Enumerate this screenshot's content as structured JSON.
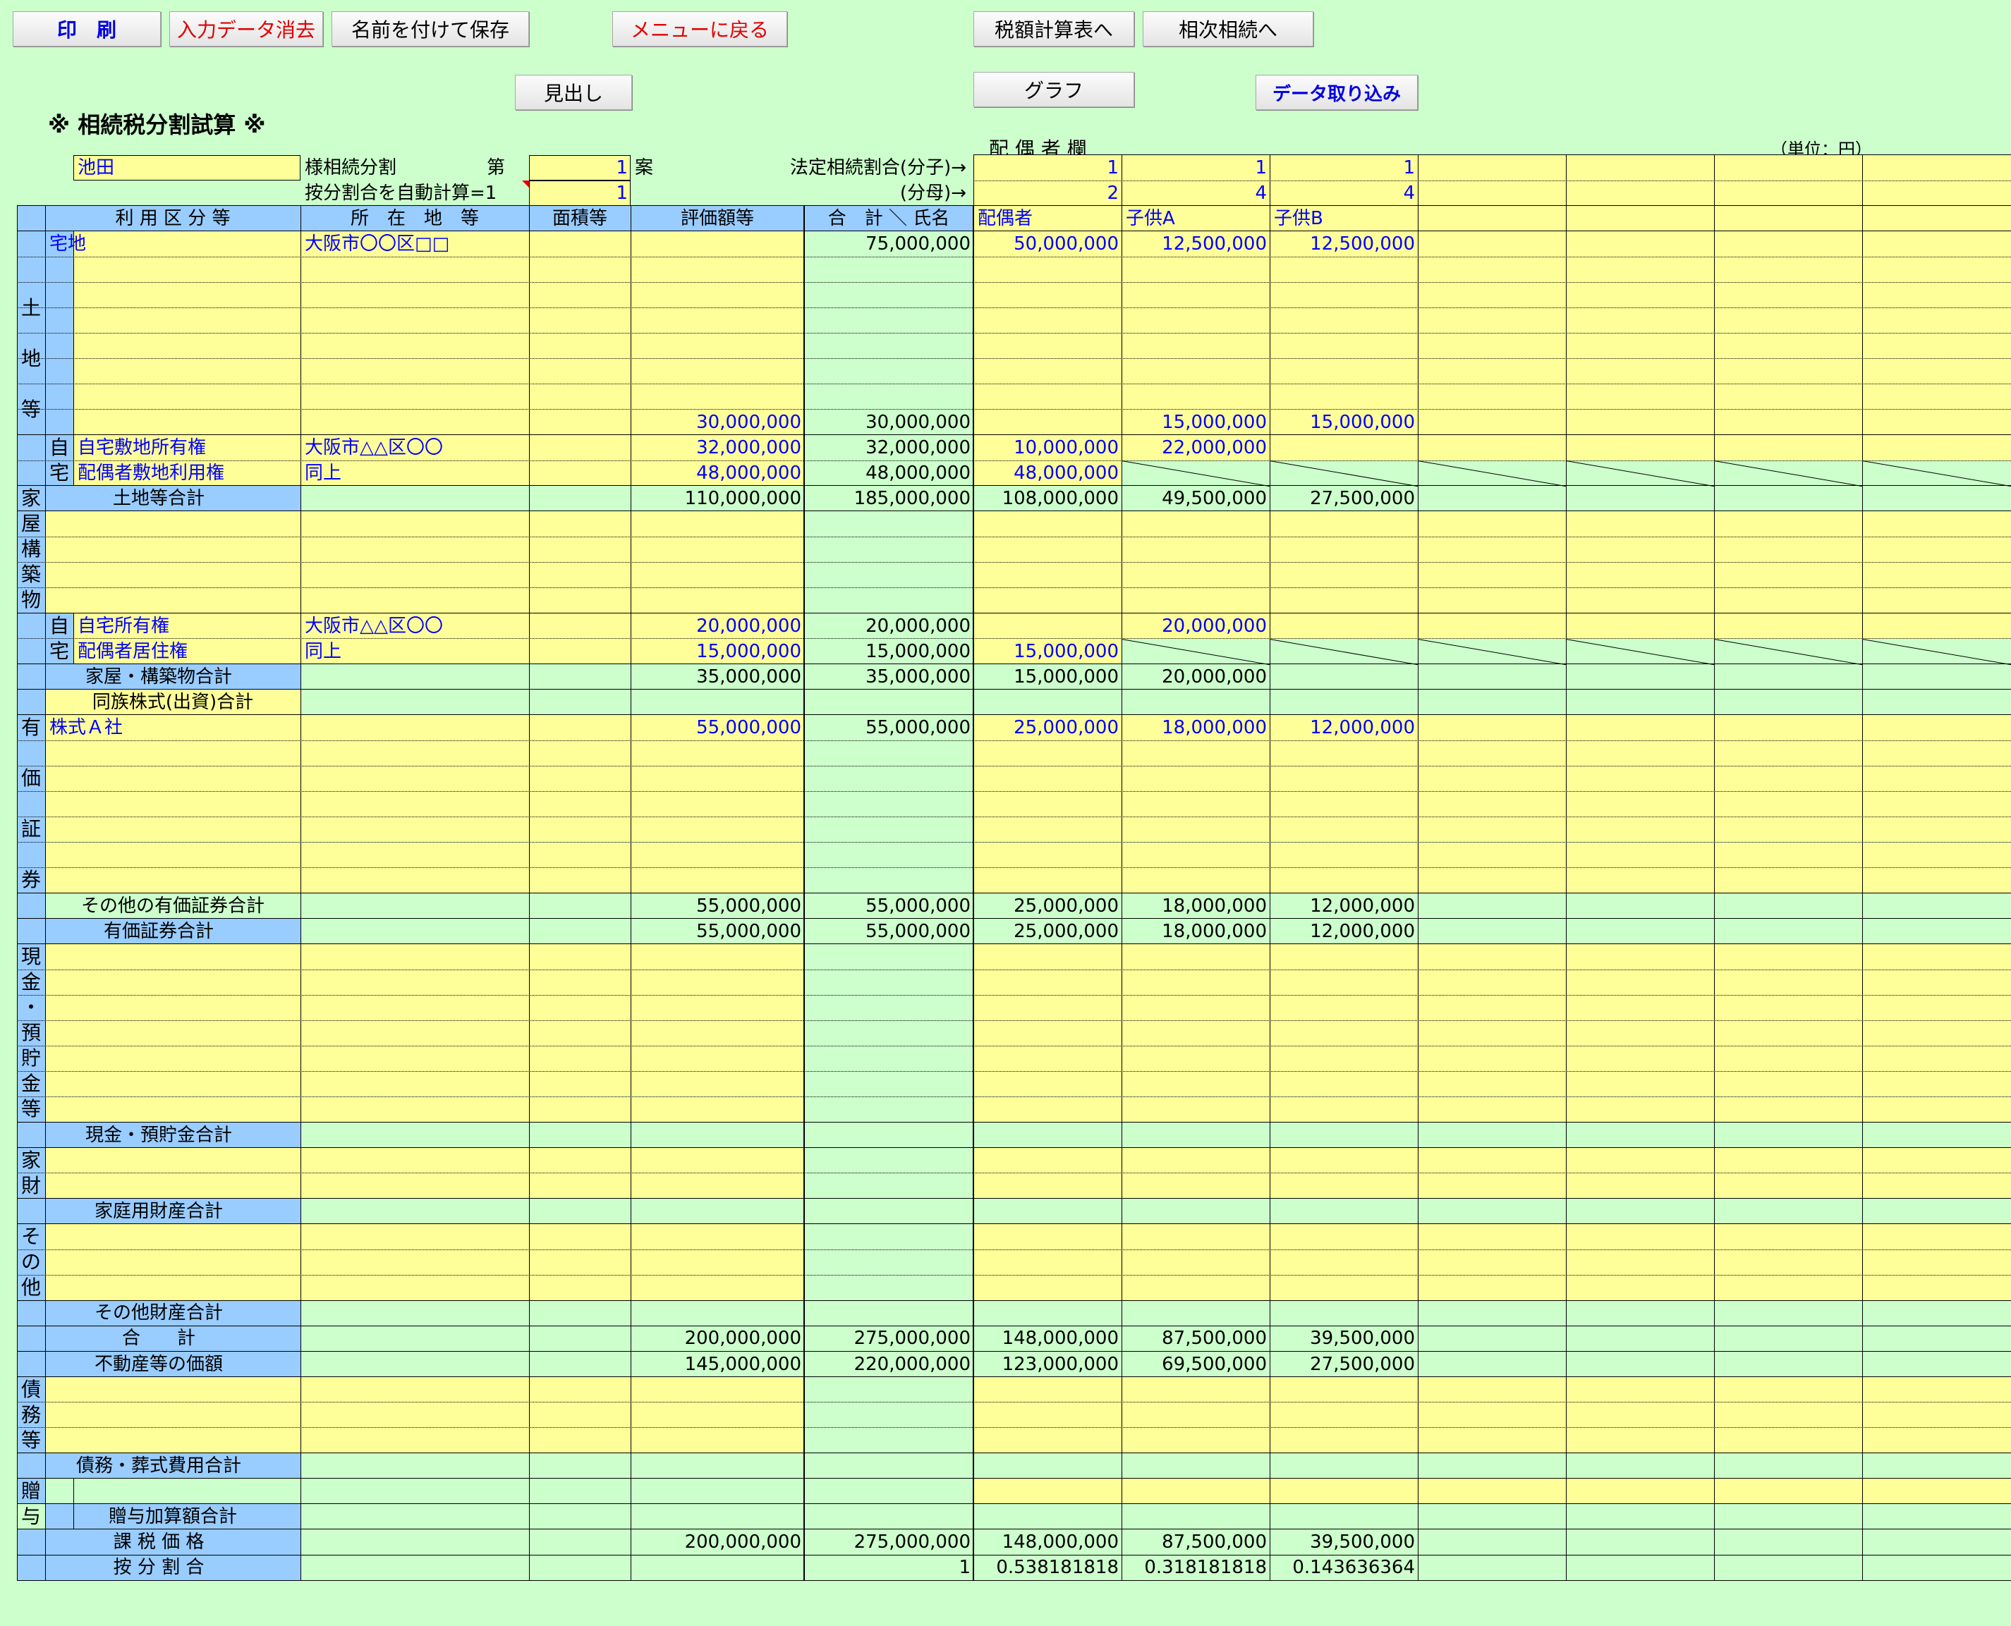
{
  "toolbar": {
    "print": "印　刷",
    "clear": "入力データ消去",
    "save_as": "名前を付けて保存",
    "menu": "メニューに戻る",
    "tax_table": "税額計算表へ",
    "next_inheritance": "相次相続へ",
    "heading": "見出し",
    "graph": "グラフ",
    "import": "データ取り込み"
  },
  "page": {
    "title": "※ 相続税分割試算 ※",
    "spouse_col": "配 偶 者 欄",
    "unit": "（単位：円）"
  },
  "setup": {
    "name": "池田",
    "sama_label": "様相続分割",
    "dai": "第",
    "plan_no": "1",
    "an": "案",
    "auto_label": "按分割合を自動計算=1",
    "auto_value": "1",
    "ratio_num_label": "法定相続割合(分子)→",
    "ratio_den_label": "(分母)→",
    "numerators": [
      "1",
      "1",
      "1"
    ],
    "denominators": [
      "2",
      "4",
      "4"
    ]
  },
  "headers": {
    "usage": "利 用 区 分 等",
    "location": "所　在　地　等",
    "area": "面積等",
    "value": "評価額等",
    "total_name": "合　計 ＼ 氏名",
    "heirs": [
      "配偶者",
      "子供A",
      "子供B"
    ]
  },
  "sections": {
    "land": "土\n\n地\n\n等",
    "home1": "自",
    "home2": "宅",
    "building": "家\n屋\n構\n築\n物",
    "securities": "有\n\n価\n\n証\n\n券",
    "cash": "現\n金\n・\n預\n貯\n金\n等",
    "household": "家\n財",
    "other": "そ\nの\n他",
    "debt": "債\n務\n等",
    "gift": "贈\n与"
  },
  "rows": {
    "r1": {
      "usage": "宅地",
      "location": "大阪市〇〇区□□",
      "total": "75,000,000",
      "h": [
        "50,000,000",
        "12,500,000",
        "12,500,000"
      ]
    },
    "r8": {
      "value": "30,000,000",
      "total": "30,000,000",
      "h": [
        "",
        "15,000,000",
        "15,000,000"
      ]
    },
    "r9": {
      "usage": "自宅敷地所有権",
      "location": "大阪市△△区〇〇",
      "value": "32,000,000",
      "total": "32,000,000",
      "h": [
        "10,000,000",
        "22,000,000",
        ""
      ]
    },
    "r10": {
      "usage": "配偶者敷地利用権",
      "location": "同上",
      "value": "48,000,000",
      "total": "48,000,000",
      "h": [
        "48,000,000",
        "",
        ""
      ]
    },
    "r11": {
      "label": "土地等合計",
      "value": "110,000,000",
      "total": "185,000,000",
      "h": [
        "108,000,000",
        "49,500,000",
        "27,500,000"
      ]
    },
    "r16": {
      "usage": "自宅所有権",
      "location": "大阪市△△区〇〇",
      "value": "20,000,000",
      "total": "20,000,000",
      "h": [
        "",
        "20,000,000",
        ""
      ]
    },
    "r17": {
      "usage": "配偶者居住権",
      "location": "同上",
      "value": "15,000,000",
      "total": "15,000,000",
      "h": [
        "15,000,000",
        "",
        ""
      ]
    },
    "r18": {
      "label": "家屋・構築物合計",
      "value": "35,000,000",
      "total": "35,000,000",
      "h": [
        "15,000,000",
        "20,000,000",
        ""
      ]
    },
    "r19": {
      "label": "同族株式(出資)合計"
    },
    "r20": {
      "usage": "株式Ａ社",
      "value": "55,000,000",
      "total": "55,000,000",
      "h": [
        "25,000,000",
        "18,000,000",
        "12,000,000"
      ]
    },
    "r27": {
      "label": "その他の有価証券合計",
      "value": "55,000,000",
      "total": "55,000,000",
      "h": [
        "25,000,000",
        "18,000,000",
        "12,000,000"
      ]
    },
    "r28": {
      "label": "有価証券合計",
      "value": "55,000,000",
      "total": "55,000,000",
      "h": [
        "25,000,000",
        "18,000,000",
        "12,000,000"
      ]
    },
    "r36": {
      "label": "現金・預貯金合計"
    },
    "r39": {
      "label": "家庭用財産合計"
    },
    "r43": {
      "label": "その他財産合計"
    },
    "r44": {
      "label": "合　　計",
      "value": "200,000,000",
      "total": "275,000,000",
      "h": [
        "148,000,000",
        "87,500,000",
        "39,500,000"
      ]
    },
    "r45": {
      "label": "不動産等の価額",
      "value": "145,000,000",
      "total": "220,000,000",
      "h": [
        "123,000,000",
        "69,500,000",
        "27,500,000"
      ]
    },
    "r49": {
      "label": "債務・葬式費用合計"
    },
    "r51": {
      "label": "贈与加算額合計"
    },
    "r52": {
      "label": "課 税 価 格",
      "value": "200,000,000",
      "total": "275,000,000",
      "h": [
        "148,000,000",
        "87,500,000",
        "39,500,000"
      ]
    },
    "r53": {
      "label": "按 分 割 合",
      "total": "1",
      "h": [
        "0.538181818",
        "0.318181818",
        "0.143636364"
      ]
    }
  },
  "colors": {
    "bg": "#ccffcc",
    "input": "#ffff99",
    "header": "#99ccff",
    "input_text": "#0000ff"
  }
}
